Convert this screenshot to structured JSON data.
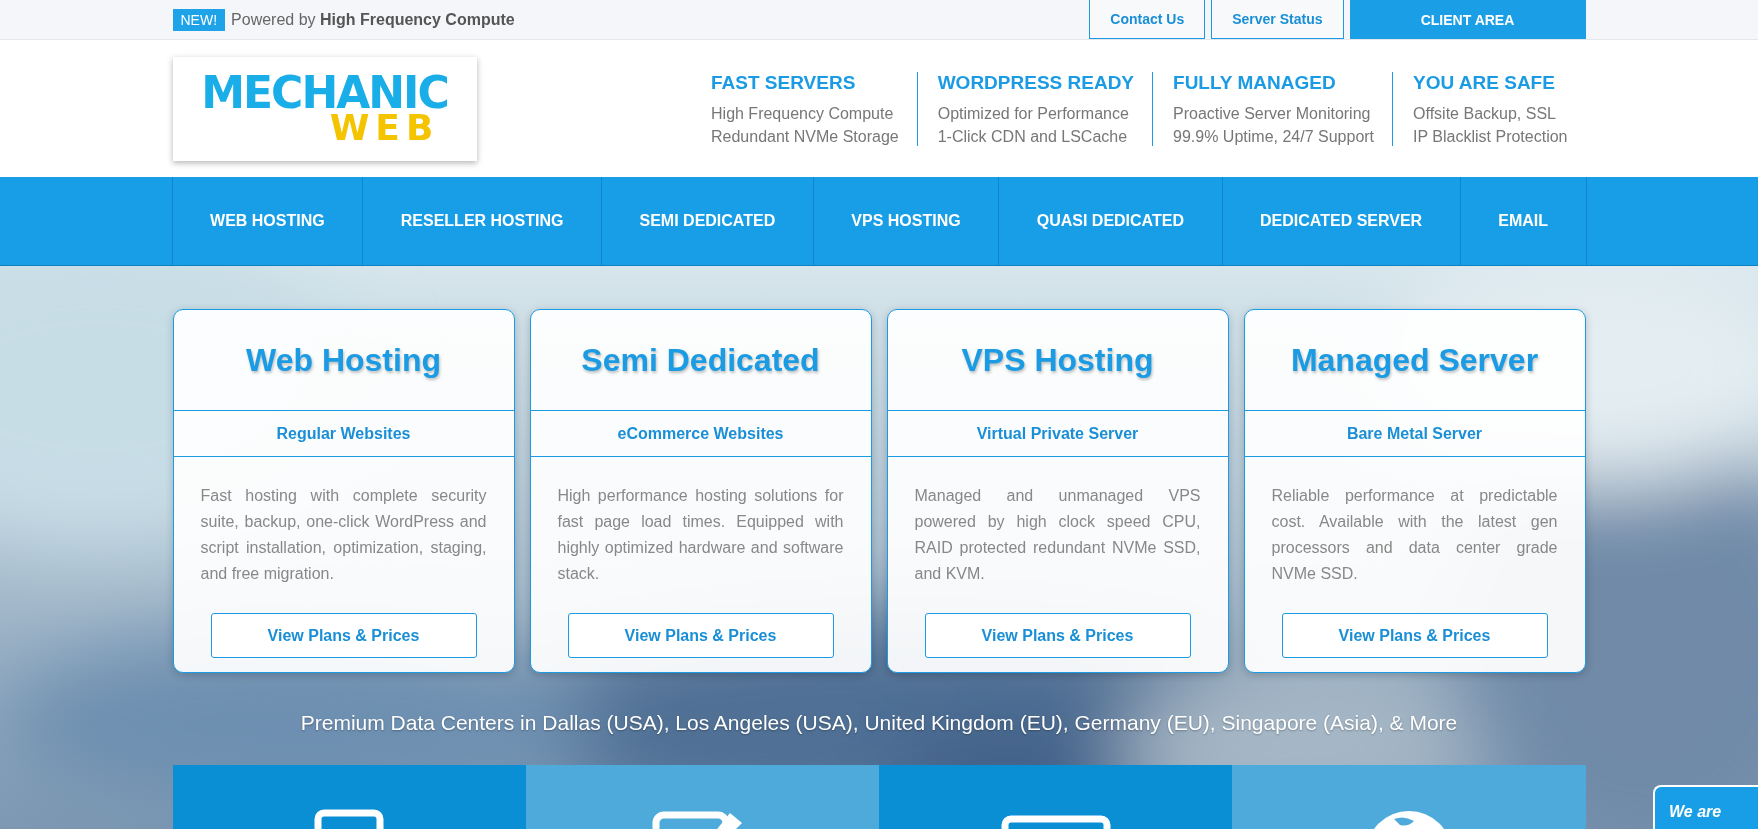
{
  "top_bar": {
    "badge": "NEW!",
    "tagline": "Powered by **High Frequency Compute**",
    "links": [
      {
        "label": "Contact Us",
        "kind": "outline"
      },
      {
        "label": "Server Status",
        "kind": "outline"
      },
      {
        "label": "CLIENT AREA",
        "kind": "filled"
      }
    ]
  },
  "logo": {
    "line_1": "MECHANIC",
    "line_2": "WEB"
  },
  "features": [
    {
      "title": "FAST SERVERS",
      "lines": [
        "High Frequency Compute",
        "Redundant NVMe Storage"
      ]
    },
    {
      "title": "WORDPRESS READY",
      "lines": [
        "Optimized for Performance",
        "1-Click CDN and LSCache"
      ]
    },
    {
      "title": "FULLY MANAGED",
      "lines": [
        "Proactive Server Monitoring",
        "99.9% Uptime, 24/7 Support"
      ]
    },
    {
      "title": "YOU ARE SAFE",
      "lines": [
        "Offsite Backup, SSL",
        "IP Blacklist Protection"
      ]
    }
  ],
  "nav": [
    "WEB HOSTING",
    "RESELLER HOSTING",
    "SEMI DEDICATED",
    "VPS HOSTING",
    "QUASI DEDICATED",
    "DEDICATED SERVER",
    "EMAIL"
  ],
  "cards": [
    {
      "title": "Web Hosting",
      "subtitle": "Regular Websites",
      "text": "Fast hosting with complete security suite, backup, one-click WordPress and script installation, optimization, staging, and free migration.",
      "button": "View Plans & Prices"
    },
    {
      "title": "Semi Dedicated",
      "subtitle": "eCommerce Websites",
      "text": "High performance hosting solutions for fast page load times. Equipped with highly optimized hardware and software stack.",
      "button": "View Plans & Prices"
    },
    {
      "title": "VPS Hosting",
      "subtitle": "Virtual Private Server",
      "text": "Managed and unmanaged VPS powered by high clock speed CPU, RAID protected redundant NVMe SSD, and KVM.",
      "button": "View Plans & Prices"
    },
    {
      "title": "Managed Server",
      "subtitle": "Bare Metal Server",
      "text": "Reliable performance at predictable cost. Available with the latest gen processors and data center grade NVMe SSD.",
      "button": "View Plans & Prices"
    }
  ],
  "datacenters": "Premium Data Centers in Dallas (USA), Los Angeles (USA), United Kingdom (EU), Germany (EU), Singapore (Asia), & More",
  "tiles": [
    {
      "kind": "monitor",
      "color": "#0a8ed4"
    },
    {
      "kind": "edit",
      "color": "#4eaadb"
    },
    {
      "kind": "screen",
      "color": "#0a8ed4"
    },
    {
      "kind": "globe",
      "color": "#4eaadb"
    }
  ],
  "chat": {
    "text": "We are"
  }
}
